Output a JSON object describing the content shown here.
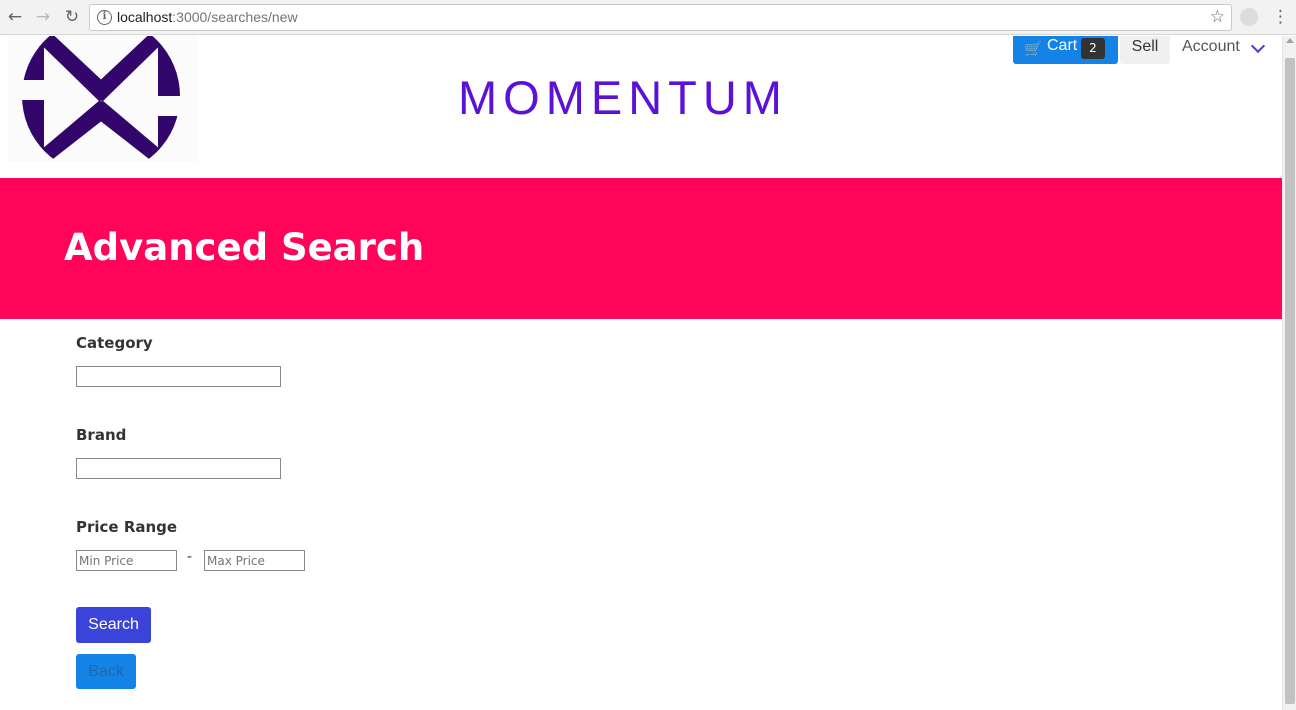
{
  "browser": {
    "url_host": "localhost",
    "url_path": ":3000/searches/new"
  },
  "header": {
    "brand_title": "MOMENTUM",
    "cart_label": "Cart",
    "cart_count": "2",
    "sell_label": "Sell",
    "account_label": "Account"
  },
  "banner": {
    "title": "Advanced Search"
  },
  "form": {
    "category_label": "Category",
    "category_value": "",
    "brand_label": "Brand",
    "brand_value": "",
    "price_label": "Price Range",
    "min_price_placeholder": "Min Price",
    "max_price_placeholder": "Max Price",
    "separator": "-",
    "search_button": "Search",
    "back_button": "Back"
  },
  "colors": {
    "brand": "#5b12d6",
    "banner": "#ff0458",
    "cart_button": "#1383e8",
    "search_button": "#3a44d8"
  }
}
